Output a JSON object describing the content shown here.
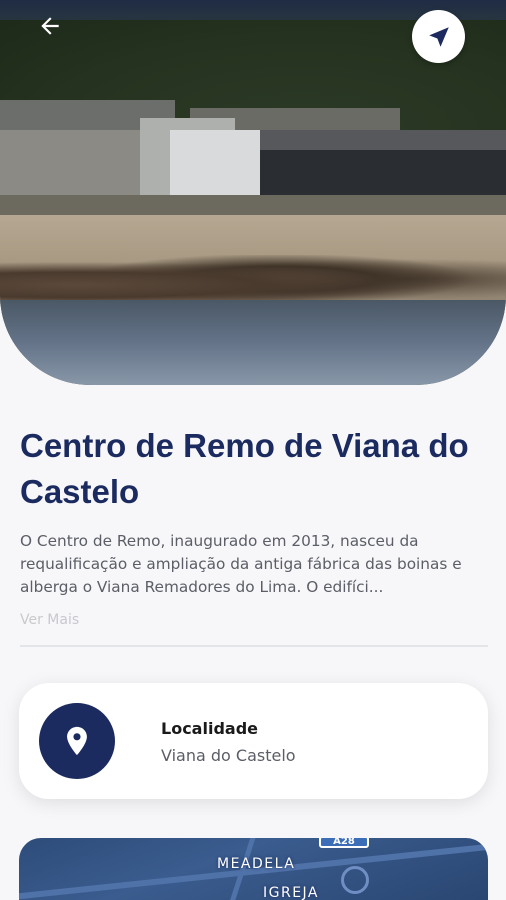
{
  "header": {
    "back_icon": "arrow-left-icon",
    "navigate_icon": "navigation-arrow-icon"
  },
  "place": {
    "title": "Centro de Remo de Viana do Castelo",
    "description": "O Centro de Remo, inaugurado em 2013, nasceu da requalificação e ampliação da antiga fábrica das boinas e alberga o Viana Remadores do Lima. O edifíci...",
    "more_label": "Ver Mais"
  },
  "location_card": {
    "icon": "location-pin-icon",
    "label": "Localidade",
    "value": "Viana do Castelo"
  },
  "map": {
    "road_shield": "A28",
    "place_1": "MEADELA",
    "place_2": "IGREJA"
  },
  "colors": {
    "primary": "#1b2a5f",
    "text_muted": "#5b5e66",
    "link_muted": "#c8c9cd",
    "background": "#f7f7f9"
  }
}
